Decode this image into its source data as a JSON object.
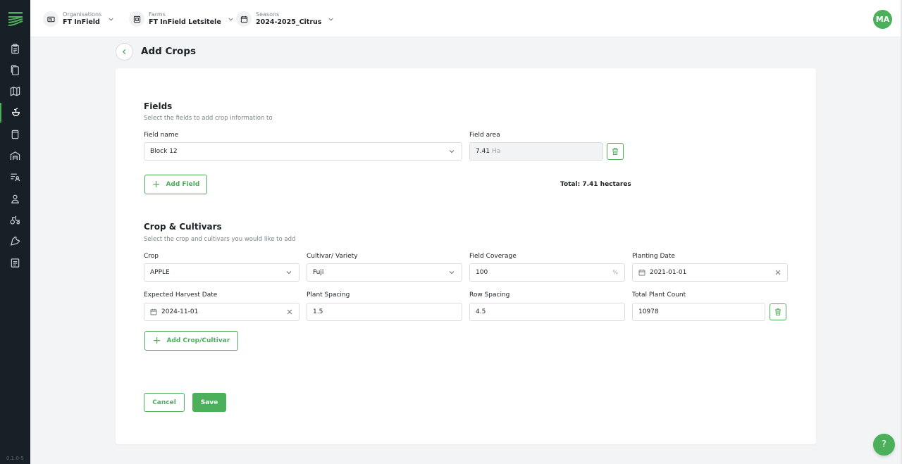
{
  "app": {
    "version": "0.1.0-5",
    "user_initials": "MA",
    "accent": "#4caf5a"
  },
  "sidebar": {
    "items": [
      {
        "icon": "clipboard-icon"
      },
      {
        "icon": "pages-icon"
      },
      {
        "icon": "map-icon"
      },
      {
        "icon": "crop-icon",
        "active": true
      },
      {
        "icon": "inventory-icon"
      },
      {
        "icon": "building-icon"
      },
      {
        "icon": "list-user-icon"
      },
      {
        "icon": "user-icon"
      },
      {
        "icon": "tractor-icon"
      },
      {
        "icon": "wrench-icon"
      },
      {
        "icon": "document-icon"
      }
    ]
  },
  "header": {
    "organisations": {
      "label": "Organisations",
      "value": "FT InField"
    },
    "farms": {
      "label": "Farms",
      "value": "FT InField Letsitele"
    },
    "seasons": {
      "label": "Seasons",
      "value": "2024-2025_Citrus"
    }
  },
  "page": {
    "title": "Add Crops"
  },
  "fields": {
    "title": "Fields",
    "subtitle": "Select the fields to add crop information to",
    "field_name_label": "Field name",
    "field_area_label": "Field area",
    "field_name_value": "Block 12",
    "field_area_value": "7.41",
    "field_area_unit": "Ha",
    "add_field_label": "Add Field",
    "total_text": "Total: 7.41 hectares"
  },
  "crops": {
    "title": "Crop & Cultivars",
    "subtitle": "Select the crop and cultivars you would like to add",
    "crop_label": "Crop",
    "crop_value": "APPLE",
    "cultivar_label": "Cultivar/ Variety",
    "cultivar_value": "Fuji",
    "coverage_label": "Field Coverage",
    "coverage_value": "100",
    "coverage_unit": "%",
    "planting_label": "Planting Date",
    "planting_value": "2021-01-01",
    "harvest_label": "Expected Harvest Date",
    "harvest_value": "2024-11-01",
    "plant_spacing_label": "Plant Spacing",
    "plant_spacing_value": "1.5",
    "row_spacing_label": "Row Spacing",
    "row_spacing_value": "4.5",
    "plant_count_label": "Total Plant Count",
    "plant_count_value": "10978",
    "add_crop_label": "Add Crop/Cultivar"
  },
  "actions": {
    "cancel_label": "Cancel",
    "save_label": "Save"
  },
  "help": {
    "label": "?"
  }
}
